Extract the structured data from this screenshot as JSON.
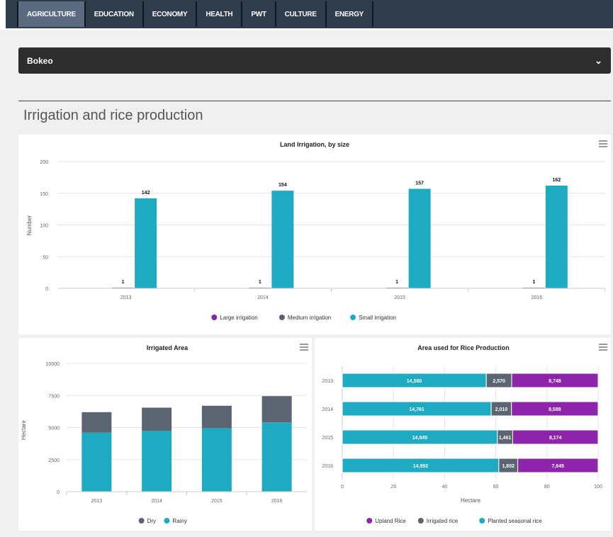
{
  "nav": {
    "tabs": [
      {
        "label": "AGRICULTURE",
        "active": true
      },
      {
        "label": "EDUCATION",
        "active": false
      },
      {
        "label": "ECONOMY",
        "active": false
      },
      {
        "label": "HEALTH",
        "active": false
      },
      {
        "label": "PWT",
        "active": false
      },
      {
        "label": "CULTURE",
        "active": false
      },
      {
        "label": "ENERGY",
        "active": false
      }
    ]
  },
  "province_select": {
    "value": "Bokeo"
  },
  "section": {
    "title": "Irrigation and rice production"
  },
  "colors": {
    "large": "#8e24aa",
    "medium": "#5b6572",
    "small": "#1eabc1",
    "dry": "#5b6572",
    "rainy": "#1eabc1",
    "upland": "#8e24aa",
    "irrigated": "#5b6572",
    "planted": "#1eabc1"
  },
  "chart_data": [
    {
      "type": "bar",
      "title": "Land Irrigation, by size",
      "ylabel": "Number",
      "categories": [
        "2013",
        "2014",
        "2015",
        "2016"
      ],
      "ylim": [
        0,
        200
      ],
      "yticks": [
        0,
        50,
        100,
        150,
        200
      ],
      "series": [
        {
          "name": "Large irrigation",
          "values": [
            0,
            0,
            0,
            0
          ]
        },
        {
          "name": "Medium irrigation",
          "values": [
            1,
            1,
            1,
            1
          ]
        },
        {
          "name": "Small irrigation",
          "values": [
            142,
            154,
            157,
            162
          ]
        }
      ],
      "data_labels": {
        "medium": [
          "1",
          "1",
          "1",
          "1"
        ],
        "small": [
          "142",
          "154",
          "157",
          "162"
        ]
      },
      "legend": "bottom"
    },
    {
      "type": "bar",
      "stacked": true,
      "title": "Irrigated Area",
      "ylabel": "Hectare",
      "categories": [
        "2013",
        "2014",
        "2015",
        "2016"
      ],
      "ylim": [
        0,
        10000
      ],
      "yticks": [
        0,
        2500,
        5000,
        7500,
        10000
      ],
      "series": [
        {
          "name": "Dry",
          "values": [
            1600,
            1800,
            1750,
            2050
          ]
        },
        {
          "name": "Rainy",
          "values": [
            4600,
            4750,
            4950,
            5400
          ]
        }
      ],
      "legend": "bottom"
    },
    {
      "type": "bar",
      "orientation": "horizontal",
      "stacked": true,
      "percent": true,
      "title": "Area used for Rice Production",
      "xlabel": "Hectare",
      "categories": [
        "2013",
        "2014",
        "2015",
        "2016"
      ],
      "xlim": [
        0,
        100
      ],
      "xticks": [
        0,
        20,
        40,
        60,
        80,
        100
      ],
      "series": [
        {
          "name": "Upland Rice",
          "values": [
            8748,
            8588,
            8174,
            7645
          ]
        },
        {
          "name": "Irrigated rice",
          "values": [
            2570,
            2010,
            1461,
            1802
          ]
        },
        {
          "name": "Planted seasonal rice",
          "values": [
            14580,
            14761,
            14845,
            14892
          ]
        }
      ],
      "data_labels": {
        "upland": [
          "8,748",
          "8,588",
          "8,174",
          "7,645"
        ],
        "irrigated": [
          "2,570",
          "2,010",
          "1,461",
          "1,802"
        ],
        "planted": [
          "14,580",
          "14,761",
          "14,845",
          "14,892"
        ]
      },
      "legend": "bottom"
    }
  ]
}
